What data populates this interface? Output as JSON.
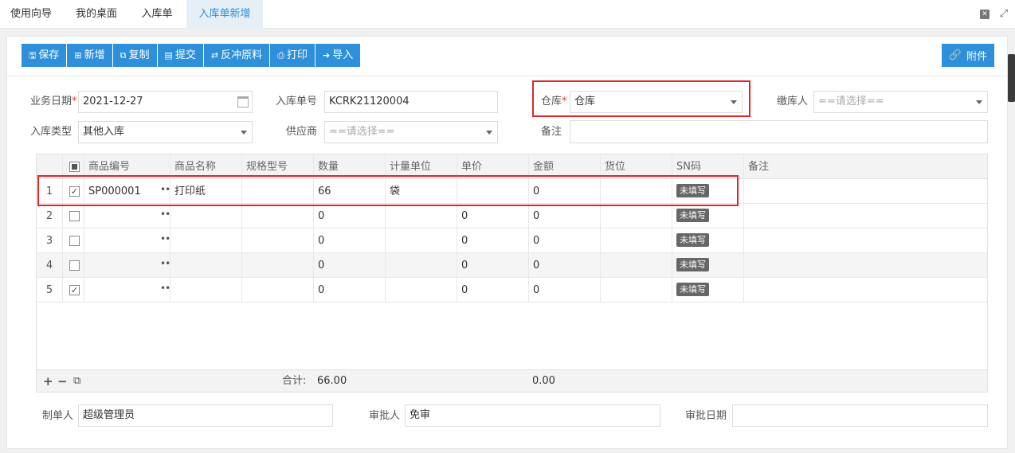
{
  "tabs": [
    {
      "label": "使用向导"
    },
    {
      "label": "我的桌面"
    },
    {
      "label": "入库单"
    },
    {
      "label": "入库单新增"
    }
  ],
  "toolbar": {
    "save": "保存",
    "add": "新增",
    "copy": "复制",
    "submit": "提交",
    "reverse": "反冲原料",
    "print": "打印",
    "import": "导入",
    "attach": "附件"
  },
  "form": {
    "biz_date_label": "业务日期",
    "biz_date": "2021-12-27",
    "order_no_label": "入库单号",
    "order_no": "KCRK21120004",
    "warehouse_label": "仓库",
    "warehouse": "仓库",
    "payer_label": "缴库人",
    "payer_placeholder": "==请选择==",
    "type_label": "入库类型",
    "type": "其他入库",
    "supplier_label": "供应商",
    "supplier_placeholder": "==请选择==",
    "remark_label": "备注",
    "remark": ""
  },
  "grid": {
    "columns": [
      "商品编号",
      "商品名称",
      "规格型号",
      "数量",
      "计量单位",
      "单价",
      "金额",
      "货位",
      "SN码",
      "备注"
    ],
    "rows": [
      {
        "no": "1",
        "checked": "✓",
        "code": "SP000001",
        "name": "打印纸",
        "spec": "",
        "qty": "66",
        "unit": "袋",
        "price": "",
        "amount": "0",
        "loc": "",
        "sn": "未填写",
        "remark": ""
      },
      {
        "no": "2",
        "checked": "",
        "code": "",
        "name": "",
        "spec": "",
        "qty": "0",
        "unit": "",
        "price": "0",
        "amount": "0",
        "loc": "",
        "sn": "未填写",
        "remark": ""
      },
      {
        "no": "3",
        "checked": "",
        "code": "",
        "name": "",
        "spec": "",
        "qty": "0",
        "unit": "",
        "price": "0",
        "amount": "0",
        "loc": "",
        "sn": "未填写",
        "remark": ""
      },
      {
        "no": "4",
        "checked": "",
        "code": "",
        "name": "",
        "spec": "",
        "qty": "0",
        "unit": "",
        "price": "0",
        "amount": "0",
        "loc": "",
        "sn": "未填写",
        "remark": ""
      },
      {
        "no": "5",
        "checked": "✓",
        "code": "",
        "name": "",
        "spec": "",
        "qty": "0",
        "unit": "",
        "price": "0",
        "amount": "0",
        "loc": "",
        "sn": "未填写",
        "remark": ""
      }
    ],
    "total_label": "合计:",
    "total_qty": "66.00",
    "total_amount": "0.00"
  },
  "footer": {
    "maker_label": "制单人",
    "maker": "超级管理员",
    "approver_label": "审批人",
    "approver": "免审",
    "approve_date_label": "审批日期",
    "approve_date": ""
  }
}
